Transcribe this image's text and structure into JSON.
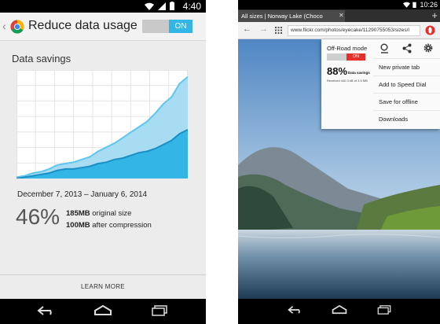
{
  "left": {
    "status": {
      "time": "4:40"
    },
    "appbar": {
      "title": "Reduce data usage",
      "toggle_label": "ON",
      "logo_icon": "chrome-logo-icon"
    },
    "section_heading": "Data savings",
    "date_range": "December 7, 2013 – January 6, 2014",
    "percent": "46%",
    "original_size_value": "185MB",
    "original_size_label": " original size",
    "compressed_value": "100MB",
    "compressed_label": " after compression",
    "learn_more": "LEARN MORE",
    "colors": {
      "accent": "#33b5e5",
      "chart_light": "#a8dcf2",
      "chart_dark": "#33b5e5"
    },
    "chart_data": {
      "type": "area",
      "series": [
        {
          "values": [
            1,
            2,
            4,
            5,
            7,
            10,
            11,
            12,
            14,
            16,
            20,
            23,
            26,
            30,
            34,
            38,
            42,
            48,
            55,
            60,
            70,
            75
          ]
        },
        {
          "values": [
            0,
            1,
            2,
            3,
            4,
            6,
            7,
            7,
            8,
            9,
            11,
            12,
            14,
            15,
            17,
            19,
            20,
            22,
            25,
            28,
            33,
            36
          ]
        }
      ],
      "grid": true
    }
  },
  "right": {
    "status": {
      "time": "10:26"
    },
    "tab_title": "All sizes | Norway Lake (Choco",
    "url": "www.flickr.com/photos/eyecake/11290755053/sizes/l",
    "menu": {
      "offroad_label": "Off-Road mode",
      "offroad_toggle": "ON",
      "savings_percent": "88%",
      "savings_label": "Data savings",
      "received_text": "Received 440.3 kB of 3.5 MB",
      "icons": [
        "search-icon",
        "share-icon",
        "settings-icon"
      ],
      "items": [
        "New private tab",
        "Add to Speed Dial",
        "Save for offline",
        "Downloads"
      ]
    },
    "colors": {
      "opera_red": "#e5302a"
    }
  }
}
